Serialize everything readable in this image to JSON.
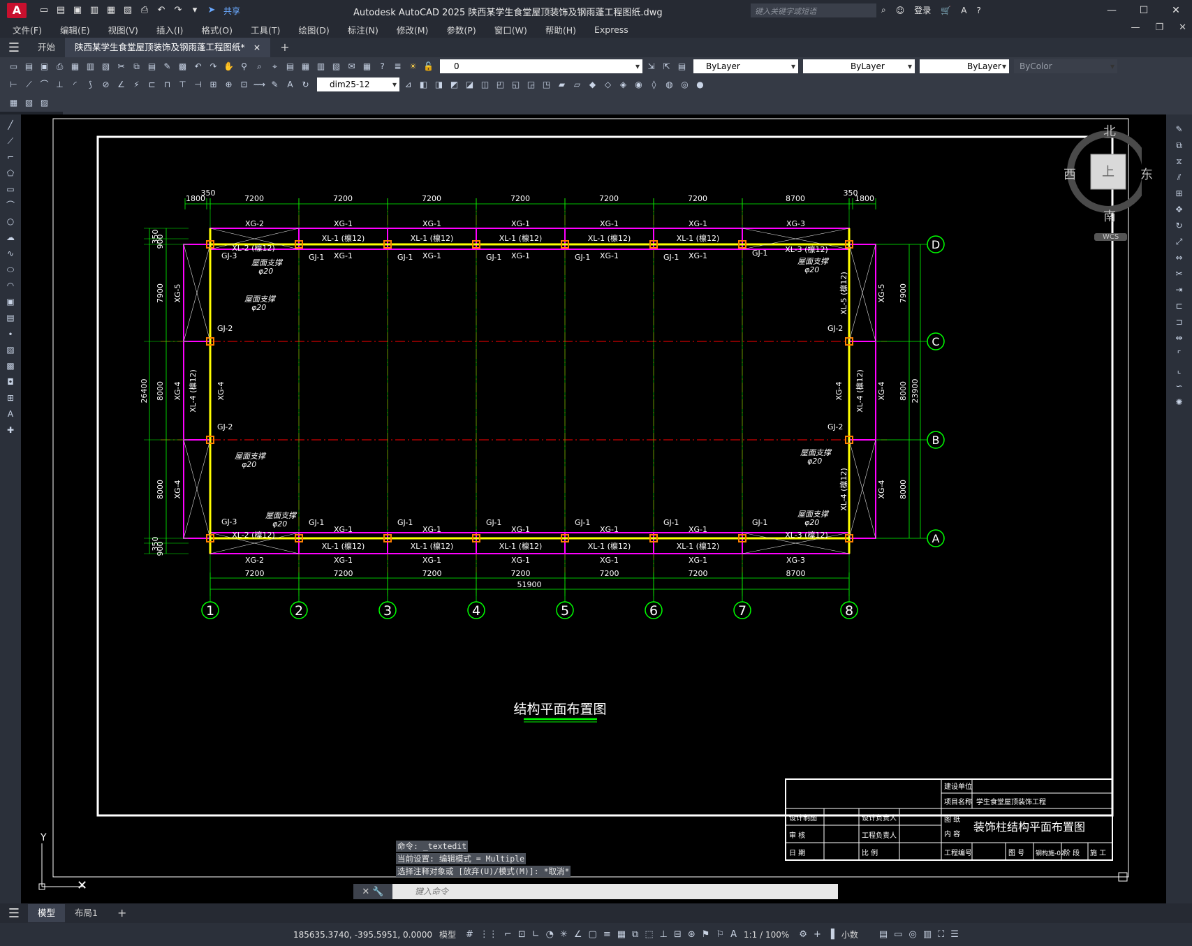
{
  "titlebar": {
    "app_title": "Autodesk AutoCAD 2025    陕西某学生食堂屋顶装饰及钢雨蓬工程图纸.dwg",
    "share_label": "共享",
    "search_placeholder": "键入关键字或短语",
    "login_label": "登录",
    "logo": "A"
  },
  "menu": [
    "文件(F)",
    "编辑(E)",
    "视图(V)",
    "插入(I)",
    "格式(O)",
    "工具(T)",
    "绘图(D)",
    "标注(N)",
    "修改(M)",
    "参数(P)",
    "窗口(W)",
    "帮助(H)",
    "Express"
  ],
  "tabs": {
    "start": "开始",
    "drawing": "陕西某学生食堂屋顶装饰及钢雨蓬工程图纸*",
    "close": "×",
    "add": "+"
  },
  "toolbar": {
    "layer_value": "0",
    "color_value": "ByLayer",
    "linetype_value": "ByLayer",
    "lineweight_value": "ByLayer",
    "plotstyle_value": "ByColor",
    "dimstyle_value": "dim25-12"
  },
  "viewcube": {
    "north": "北",
    "south": "南",
    "east": "东",
    "west": "西",
    "top": "上",
    "wcs": "WCS"
  },
  "drawing": {
    "title": "结构平面布置图",
    "dims_top": [
      "1800",
      "350",
      "7200",
      "7200",
      "7200",
      "7200",
      "7200",
      "7200",
      "8700",
      "350",
      "1800"
    ],
    "dims_bottom": [
      "7200",
      "7200",
      "7200",
      "7200",
      "7200",
      "7200",
      "8700"
    ],
    "total_bottom": "51900",
    "grid_cols": [
      "1",
      "2",
      "3",
      "4",
      "5",
      "6",
      "7",
      "8"
    ],
    "grid_rows": [
      "D",
      "C",
      "B",
      "A"
    ],
    "dims_left": [
      "350",
      "900",
      "7900",
      "8000",
      "8000",
      "350",
      "900"
    ],
    "total_left": "26400",
    "dims_right": [
      "7900",
      "8000",
      "8000"
    ],
    "total_right": "23900",
    "labels": {
      "xg1": "XG-1",
      "xg2": "XG-2",
      "xg3": "XG-3",
      "xg4": "XG-4",
      "xg5": "XG-5",
      "xl1": "XL-1 (檩12)",
      "xl2": "XL-2 (檩12)",
      "xl3": "XL-3 (檩12)",
      "xl4": "XL-4 (檩12)",
      "xl5": "XL-5 (檩12)",
      "gj1": "GJ-1",
      "gj2": "GJ-2",
      "gj3": "GJ-3",
      "brace": "屋面支撑",
      "brace_size": "φ20"
    }
  },
  "titleblock": {
    "build_unit": "建设单位",
    "project_name": "项目名称",
    "project_value": "学生食堂屋顶装饰工程",
    "design_draw": "设计制图",
    "design_head": "设计负责人",
    "drawing_label": "图 纸",
    "content_label": "内 容",
    "drawing_title": "装饰柱结构平面布置图",
    "review": "审 核",
    "project_head": "工程负责人",
    "date": "日 期",
    "scale": "比 例",
    "project_no": "工程编号",
    "sheet_no": "图 号",
    "sheet_value": "钢构施-02",
    "stage": "阶 段",
    "stage_value": "施 工"
  },
  "command": {
    "history": [
      "命令: _textedit",
      "当前设置: 编辑模式 = Multiple",
      "选择注释对象或 [放弃(U)/模式(M)]: *取消*"
    ],
    "placeholder": "键入命令"
  },
  "layout_tabs": [
    "模型",
    "布局1"
  ],
  "status": {
    "coords": "185635.3740, -395.5951, 0.0000",
    "model": "模型",
    "scale": "1:1 / 100%",
    "units": "小数"
  }
}
